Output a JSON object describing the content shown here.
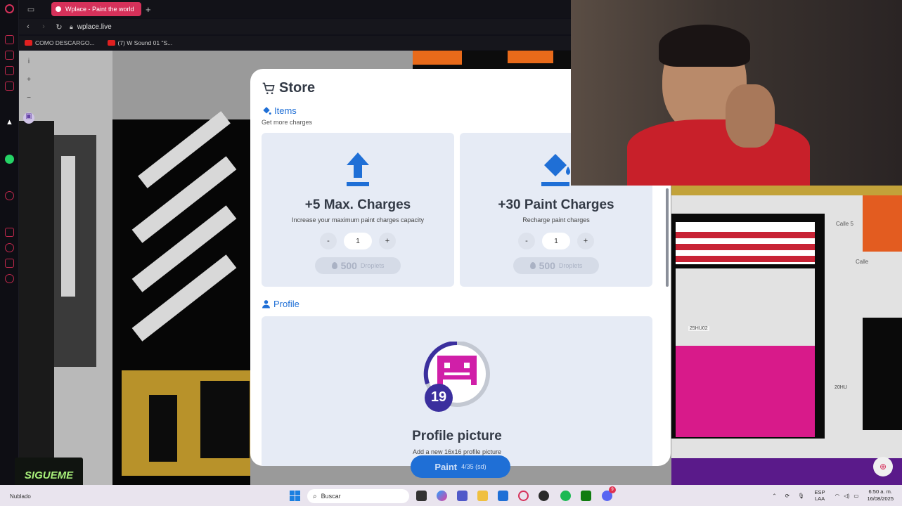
{
  "browser": {
    "tab_title": "Wplace - Paint the world",
    "address": "wplace.live",
    "bookmarks": [
      "COMO DESCARGO...",
      "(7) W Sound 01 \"S..."
    ]
  },
  "store": {
    "title": "Store",
    "items_heading": "Items",
    "items_subtitle": "Get more charges",
    "cards": [
      {
        "icon": "upload-arrow-icon",
        "title": "+5 Max. Charges",
        "subtitle": "Increase your maximum paint charges capacity",
        "minus": "-",
        "quantity": "1",
        "plus": "+",
        "price": "500",
        "price_unit": "Droplets"
      },
      {
        "icon": "paint-bucket-icon",
        "title": "+30 Paint Charges",
        "subtitle": "Recharge paint charges",
        "minus": "-",
        "quantity": "1",
        "plus": "+",
        "price": "500",
        "price_unit": "Droplets"
      }
    ],
    "profile_heading": "Profile",
    "profile_card": {
      "badge_level": "19",
      "title": "Profile picture",
      "subtitle": "Add a new 16x16 profile picture"
    },
    "paint_button": "Paint",
    "paint_counter": "4/35 (sd)"
  },
  "map_labels": [
    "Calle 5",
    "Calle",
    "25HU02",
    "20HU"
  ],
  "overlay": {
    "sigueme": "SIGUEME"
  },
  "taskbar": {
    "weather": "Nublado",
    "search_placeholder": "Buscar",
    "lang_top": "ESP",
    "lang_bottom": "LAA",
    "time": "6:50 a. m.",
    "date": "16/08/2025",
    "notification_count": "9"
  },
  "colors": {
    "accent_blue": "#1f6fd6",
    "tab_pink": "#d6315a",
    "badge_magenta": "#d01fa8",
    "badge_purple": "#3b2f9e"
  }
}
